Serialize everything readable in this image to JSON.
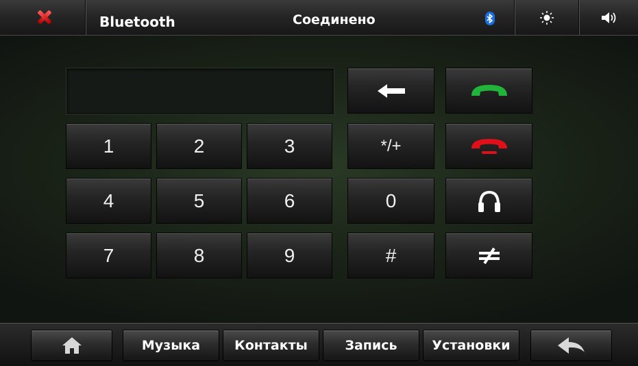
{
  "topbar": {
    "close_icon": "close-icon",
    "title": "Bluetooth",
    "status": "Соединено",
    "bluetooth_icon": "bluetooth-icon",
    "brightness_icon": "sun-icon",
    "volume_icon": "speaker-icon"
  },
  "dialpad": {
    "display_value": "",
    "digits": [
      "1",
      "2",
      "3",
      "4",
      "5",
      "6",
      "7",
      "8",
      "9"
    ],
    "star_plus": "*/+",
    "zero": "0",
    "hash": "#"
  },
  "side_keys": {
    "backspace_icon": "backspace-arrow-icon",
    "call_icon": "green-phone-icon",
    "hangup_icon": "red-phone-icon",
    "headset_icon": "headphones-icon",
    "transfer_icon": "not-equal-icon"
  },
  "bottombar": {
    "home_icon": "home-icon",
    "music": "Музыка",
    "contacts": "Контакты",
    "record": "Запись",
    "settings": "Установки",
    "back_icon": "back-arrow-icon"
  },
  "colors": {
    "call_green": "#22b33a",
    "hangup_red": "#e0101a",
    "bluetooth_blue": "#1a6fe0",
    "close_red": "#d01010"
  }
}
